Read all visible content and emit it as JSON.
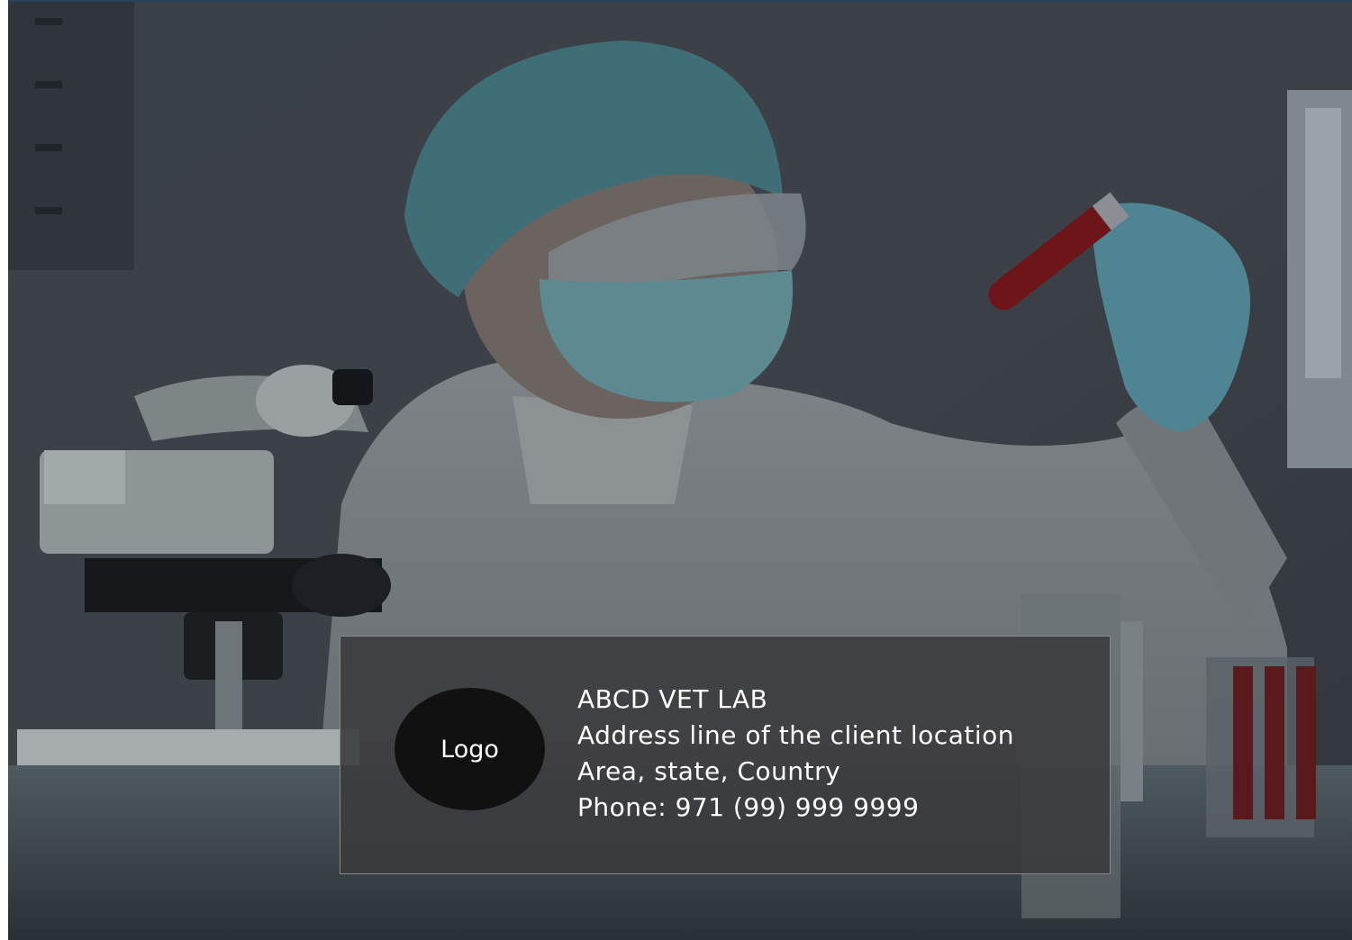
{
  "card": {
    "logo_text": "Logo",
    "lab_name": "ABCD VET LAB",
    "address_line": "Address line of the client location",
    "area_line": "Area, state, Country",
    "phone_line": "Phone: 971 (99) 999 9999"
  },
  "colors": {
    "overlay": "#3a3a3c",
    "logo_circle": "#111111",
    "text": "#ffffff",
    "test_tube": "#7a1a1e",
    "scrubs": "#5a8a94"
  }
}
